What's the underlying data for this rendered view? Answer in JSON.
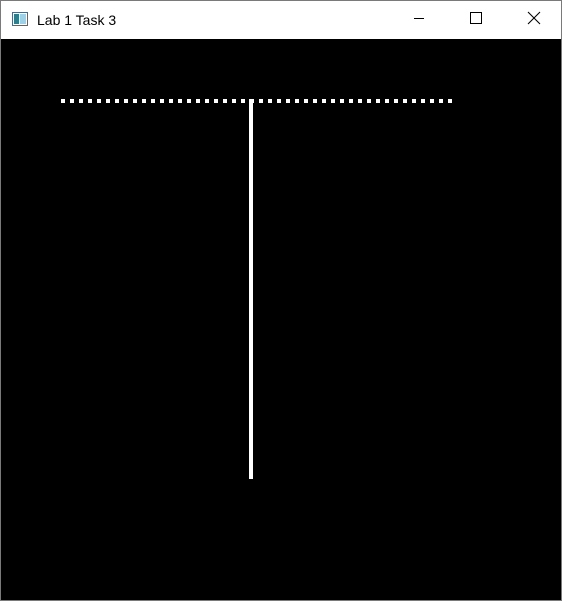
{
  "window": {
    "title": "Lab 1 Task 3",
    "icon": "app-window-icon",
    "controls": [
      "minimize",
      "maximize",
      "close"
    ]
  },
  "canvas": {
    "background_color": "#000000",
    "line_color": "#ffffff",
    "shapes": [
      {
        "name": "dotted-horizontal-line",
        "style": "dotted"
      },
      {
        "name": "solid-vertical-line",
        "style": "solid"
      }
    ]
  }
}
